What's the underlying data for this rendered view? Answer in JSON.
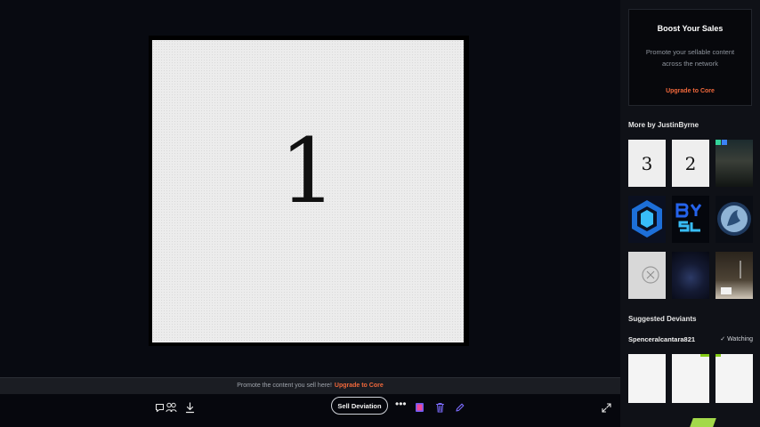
{
  "artwork": {
    "number": "1"
  },
  "promote_bar": {
    "text": "Promote the content you sell here!",
    "link": "Upgrade to Core"
  },
  "toolbar": {
    "comment_icon": "comment-icon",
    "favourite_icon": "favourite-icon",
    "download_icon": "download-icon",
    "sell_label": "Sell Deviation",
    "more_label": "•••",
    "expand_icon": "fullscreen-icon"
  },
  "sidebar": {
    "boost": {
      "title": "Boost Your Sales",
      "text": "Promote your sellable content across the network",
      "link": "Upgrade to Core"
    },
    "more_by": "More by JustinByrne",
    "thumbs": [
      {
        "kind": "number",
        "label": "3"
      },
      {
        "kind": "number",
        "label": "2"
      },
      {
        "kind": "photo-dark"
      },
      {
        "kind": "hexagon-logo"
      },
      {
        "kind": "text-logo",
        "label": "BY SL"
      },
      {
        "kind": "circle-logo"
      },
      {
        "kind": "sketch-light"
      },
      {
        "kind": "dark-glow"
      },
      {
        "kind": "photo-brown"
      }
    ],
    "suggested_title": "Suggested Deviants",
    "suggested_user": "Spenceralcantara821",
    "watching": "Watching",
    "colors": {
      "accent": "#f0683b",
      "background": "#0f1117"
    }
  }
}
